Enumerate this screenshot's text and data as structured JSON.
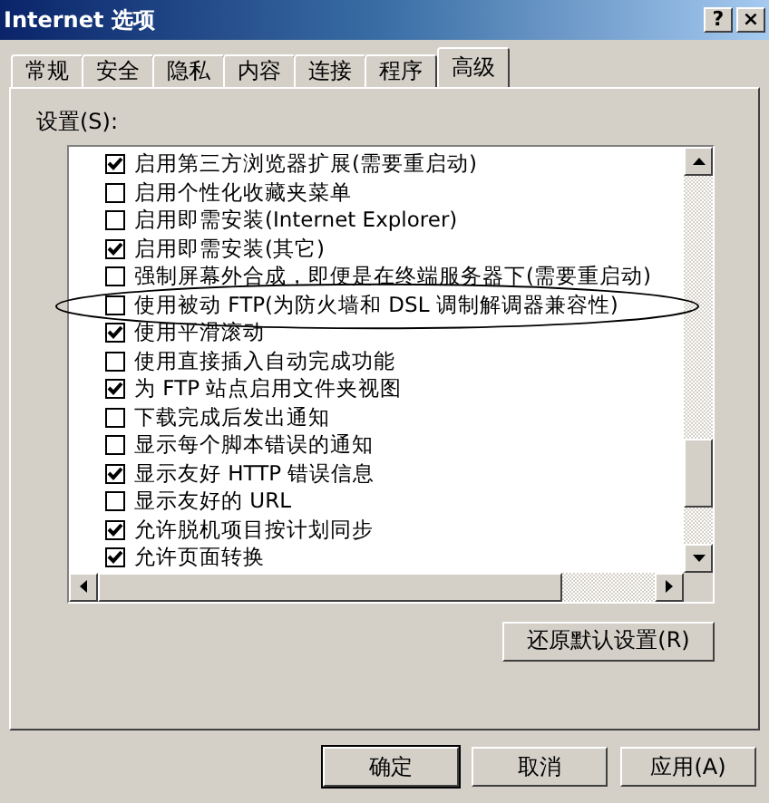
{
  "window": {
    "title": "Internet 选项",
    "help_button": "?",
    "close_button": "×"
  },
  "tabs": [
    {
      "label": "常规",
      "selected": false
    },
    {
      "label": "安全",
      "selected": false
    },
    {
      "label": "隐私",
      "selected": false
    },
    {
      "label": "内容",
      "selected": false
    },
    {
      "label": "连接",
      "selected": false
    },
    {
      "label": "程序",
      "selected": false
    },
    {
      "label": "高级",
      "selected": true
    }
  ],
  "settings_label": "设置(S):",
  "settings": [
    {
      "label": "启用第三方浏览器扩展(需要重启动)",
      "checked": true,
      "circled": false
    },
    {
      "label": "启用个性化收藏夹菜单",
      "checked": false,
      "circled": false
    },
    {
      "label": "启用即需安装(Internet Explorer)",
      "checked": false,
      "circled": false
    },
    {
      "label": "启用即需安装(其它)",
      "checked": true,
      "circled": false
    },
    {
      "label": "强制屏幕外合成，即便是在终端服务器下(需要重启动)",
      "checked": false,
      "circled": false
    },
    {
      "label": "使用被动 FTP(为防火墙和 DSL 调制解调器兼容性)",
      "checked": false,
      "circled": true
    },
    {
      "label": "使用平滑滚动",
      "checked": true,
      "circled": false
    },
    {
      "label": "使用直接插入自动完成功能",
      "checked": false,
      "circled": false
    },
    {
      "label": "为 FTP 站点启用文件夹视图",
      "checked": true,
      "circled": false
    },
    {
      "label": "下载完成后发出通知",
      "checked": false,
      "circled": false
    },
    {
      "label": "显示每个脚本错误的通知",
      "checked": false,
      "circled": false
    },
    {
      "label": "显示友好 HTTP 错误信息",
      "checked": true,
      "circled": false
    },
    {
      "label": "显示友好的 URL",
      "checked": false,
      "circled": false
    },
    {
      "label": "允许脱机项目按计划同步",
      "checked": true,
      "circled": false
    },
    {
      "label": "允许页面转换",
      "checked": true,
      "circled": false
    }
  ],
  "restore_button": "还原默认设置(R)",
  "buttons": [
    {
      "label": "确定",
      "default": true
    },
    {
      "label": "取消",
      "default": false
    },
    {
      "label": "应用(A)",
      "default": false
    }
  ]
}
